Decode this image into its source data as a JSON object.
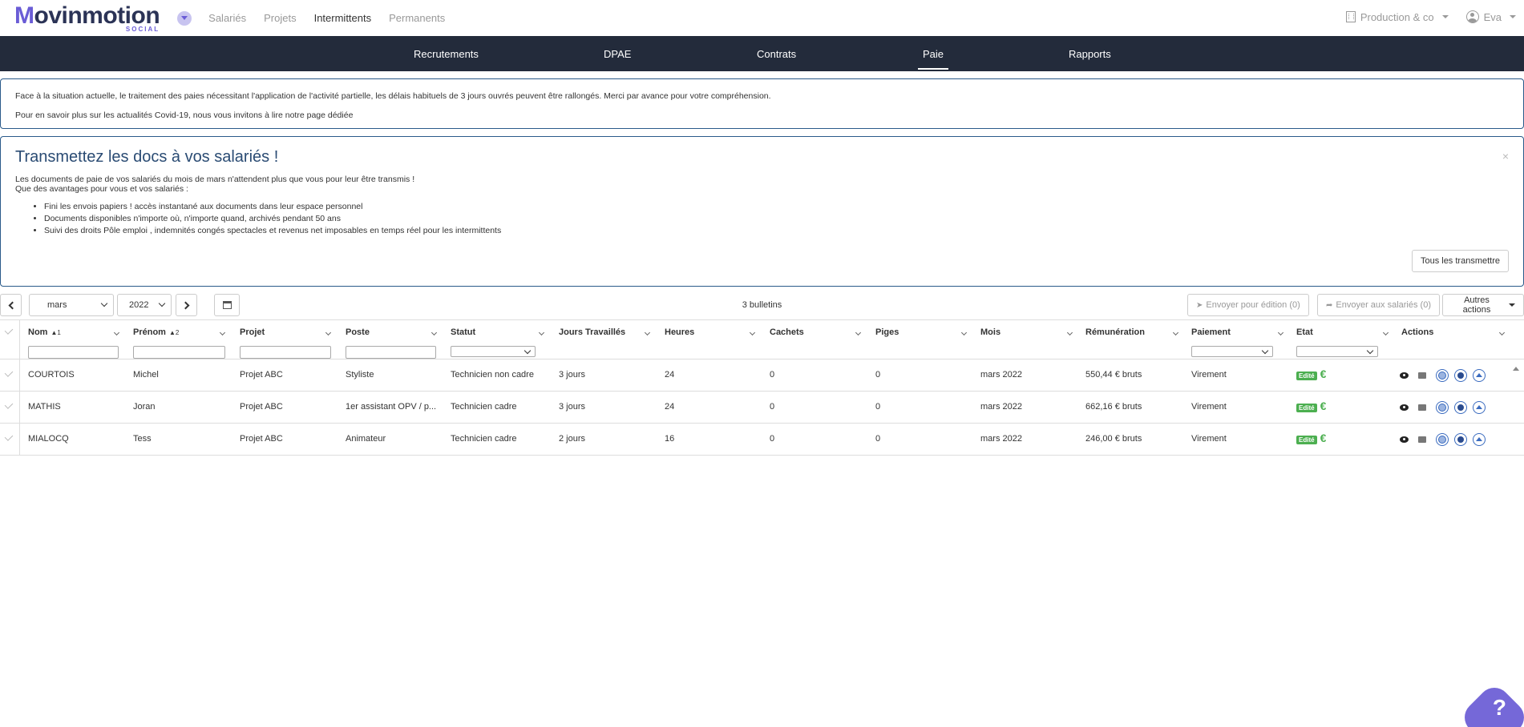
{
  "topbar": {
    "logo_main_first": "M",
    "logo_main_rest": "ovinmotion",
    "logo_sub": "SOCIAL",
    "links": [
      {
        "label": "Salariés",
        "active": false
      },
      {
        "label": "Projets",
        "active": false
      },
      {
        "label": "Intermittents",
        "active": true
      },
      {
        "label": "Permanents",
        "active": false
      }
    ],
    "company": "Production & co",
    "user": "Eva"
  },
  "mainnav": {
    "tabs": [
      {
        "label": "Recrutements"
      },
      {
        "label": "DPAE"
      },
      {
        "label": "Contrats"
      },
      {
        "label": "Paie",
        "active": true
      },
      {
        "label": "Rapports"
      }
    ]
  },
  "info": {
    "line1": "Face à la situation actuelle, le traitement des paies nécessitant l'application de l'activité partielle, les délais habituels de 3 jours ouvrés peuvent être rallongés. Merci par avance pour votre compréhension.",
    "line2": "Pour en savoir plus sur les actualités Covid-19, nous vous invitons à lire notre page dédiée"
  },
  "promo": {
    "title": "Transmettez les docs à vos salariés !",
    "line1": "Les documents de paie de vos salariés du mois de mars n'attendent plus que vous pour leur être transmis !",
    "line2": "Que des avantages pour vous et vos salariés :",
    "bullets": [
      "Fini les envois papiers ! accès instantané aux documents dans leur espace personnel",
      "Documents disponibles n'importe où, n'importe quand, archivés pendant 50 ans",
      "Suivi des droits Pôle emploi , indemnités congés spectacles et revenus net imposables en temps réel pour les intermittents"
    ],
    "close": "×",
    "button": "Tous les transmettre"
  },
  "toolbar": {
    "month": "mars",
    "year": "2022",
    "count": "3 bulletins",
    "send_edit": "Envoyer pour édition (0)",
    "send_employees": "Envoyer aux salariés (0)",
    "other_actions": "Autres actions"
  },
  "table": {
    "columns": [
      "Nom",
      "Prénom",
      "Projet",
      "Poste",
      "Statut",
      "Jours Travaillés",
      "Heures",
      "Cachets",
      "Piges",
      "Mois",
      "Rémunération",
      "Paiement",
      "Etat",
      "Actions"
    ],
    "sort_nom": "▲1",
    "sort_prenom": "▲2",
    "rows": [
      {
        "nom": "COURTOIS",
        "prenom": "Michel",
        "projet": "Projet ABC",
        "poste": "Styliste",
        "statut": "Technicien non cadre",
        "jours": "3 jours",
        "heures": "24",
        "cachets": "0",
        "piges": "0",
        "mois": "mars 2022",
        "remuneration": "550,44 € bruts",
        "paiement": "Virement",
        "etat": "Edité",
        "euro": "€"
      },
      {
        "nom": "MATHIS",
        "prenom": "Joran",
        "projet": "Projet ABC",
        "poste": "1er assistant OPV / p...",
        "statut": "Technicien cadre",
        "jours": "3 jours",
        "heures": "24",
        "cachets": "0",
        "piges": "0",
        "mois": "mars 2022",
        "remuneration": "662,16 € bruts",
        "paiement": "Virement",
        "etat": "Edité",
        "euro": "€"
      },
      {
        "nom": "MIALOCQ",
        "prenom": "Tess",
        "projet": "Projet ABC",
        "poste": "Animateur",
        "statut": "Technicien cadre",
        "jours": "2 jours",
        "heures": "16",
        "cachets": "0",
        "piges": "0",
        "mois": "mars 2022",
        "remuneration": "246,00 € bruts",
        "paiement": "Virement",
        "etat": "Edité",
        "euro": "€"
      }
    ]
  },
  "help": {
    "label": "?"
  },
  "colors": {
    "brand": "#6a5cd6",
    "nav": "#232b3b",
    "border": "#2a5a8a",
    "success": "#4caf50"
  }
}
